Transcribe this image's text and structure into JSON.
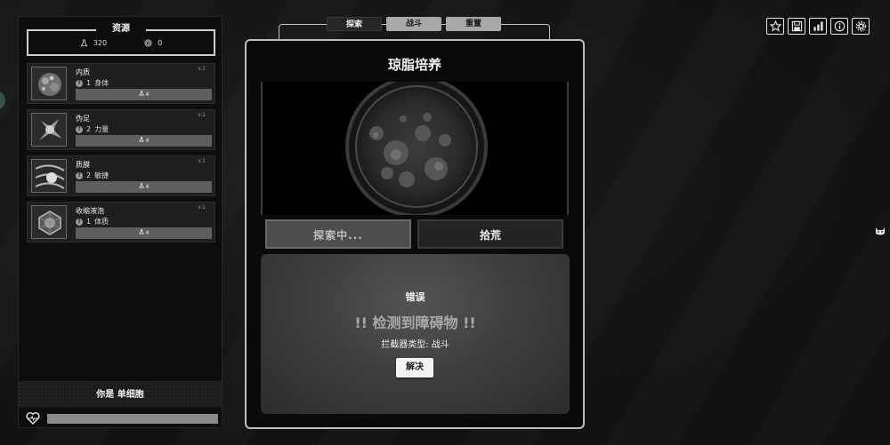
{
  "resources": {
    "title": "资源",
    "flask_count": "320",
    "spiral_count": "0"
  },
  "traits": [
    {
      "name": "内质",
      "level": "v.1",
      "stat_value": "1",
      "stat_name": "身体",
      "cost": "4"
    },
    {
      "name": "伪足",
      "level": "v.1",
      "stat_value": "2",
      "stat_name": "力量",
      "cost": "4"
    },
    {
      "name": "质膜",
      "level": "v.1",
      "stat_value": "2",
      "stat_name": "敏捷",
      "cost": "4"
    },
    {
      "name": "收缩液泡",
      "level": "v.1",
      "stat_value": "1",
      "stat_name": "体质",
      "cost": "4"
    }
  ],
  "identity": {
    "label": "你是 单细胞"
  },
  "health": {
    "fraction": 1.0
  },
  "tabs": [
    {
      "label": "探索",
      "active": true
    },
    {
      "label": "战斗",
      "active": false
    },
    {
      "label": "重置",
      "active": false
    }
  ],
  "main": {
    "title": "琼脂培养",
    "explore_label": "探索中...",
    "scavenge_label": "拾荒"
  },
  "dialog": {
    "title": "错误",
    "message": "!! 检测到障碍物 !!",
    "type_line": "拦截器类型: 战斗",
    "button": "解决"
  },
  "top_icons": [
    "star-icon",
    "save-icon",
    "stats-icon",
    "info-icon",
    "settings-icon"
  ],
  "colors": {
    "background": "#141414",
    "panel": "#0d0d0d",
    "card": "#1f1f1f",
    "accent_teal": "#35524d"
  }
}
